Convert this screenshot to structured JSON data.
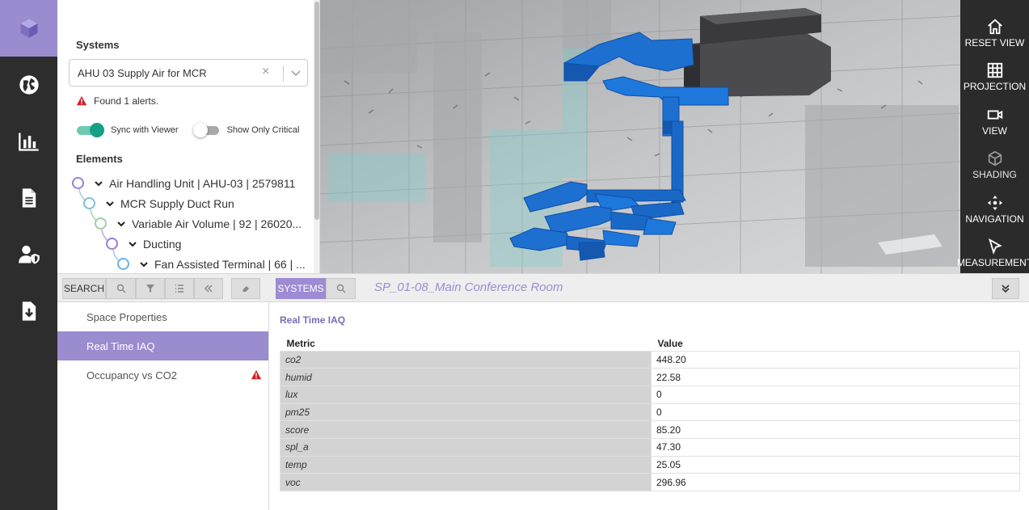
{
  "rail": {
    "items": [
      {
        "icon": "cube-icon",
        "active": true
      },
      {
        "icon": "globe-icon",
        "active": false
      },
      {
        "icon": "bar-chart-icon",
        "active": false
      },
      {
        "icon": "document-icon",
        "active": false
      },
      {
        "icon": "user-shield-icon",
        "active": false
      },
      {
        "icon": "download-file-icon",
        "active": false
      }
    ]
  },
  "systems_panel": {
    "title": "Systems",
    "selected_system": "AHU 03 Supply Air for MCR",
    "alert_text": "Found 1 alerts.",
    "sync_label": "Sync with Viewer",
    "sync_on": true,
    "critical_label": "Show Only Critical",
    "critical_on": false,
    "elements_title": "Elements",
    "tree": [
      {
        "label": "Air Handling Unit | AHU-03 | 2579811",
        "color": "#9b7fd4"
      },
      {
        "label": "MCR Supply Duct Run",
        "color": "#7fbfd0"
      },
      {
        "label": "Variable Air Volume | 92 | 26020...",
        "color": "#9fd0a8"
      },
      {
        "label": "Ducting",
        "color": "#9b7fd4"
      },
      {
        "label": "Fan Assisted Terminal | 66 | ...",
        "color": "#6fb3e0"
      }
    ]
  },
  "toolbar": {
    "reset_view": "RESET VIEW",
    "projection": "PROJECTION",
    "view": "VIEW",
    "shading": "SHADING",
    "navigation": "NAVIGATION",
    "measurement": "MEASUREMENT"
  },
  "bar": {
    "search_label": "SEARCH",
    "systems_label": "SYSTEMS",
    "space_title": "SP_01-08_Main Conference Room"
  },
  "properties_nav": {
    "items": [
      {
        "label": "Space Properties",
        "active": false,
        "alert": false
      },
      {
        "label": "Real Time IAQ",
        "active": true,
        "alert": false
      },
      {
        "label": "Occupancy vs CO2",
        "active": false,
        "alert": true
      }
    ]
  },
  "iaq": {
    "title": "Real Time IAQ",
    "col_metric": "Metric",
    "col_value": "Value",
    "rows": [
      {
        "metric": "co2",
        "value": "448.20"
      },
      {
        "metric": "humid",
        "value": "22.58"
      },
      {
        "metric": "lux",
        "value": "0"
      },
      {
        "metric": "pm25",
        "value": "0"
      },
      {
        "metric": "score",
        "value": "85.20"
      },
      {
        "metric": "spl_a",
        "value": "47.30"
      },
      {
        "metric": "temp",
        "value": "25.05"
      },
      {
        "metric": "voc",
        "value": "296.96"
      }
    ]
  },
  "colors": {
    "accent": "#9b8cd0",
    "duct_blue": "#1d6fd0",
    "alert_red": "#d11f26",
    "toggle_on": "#14a084"
  }
}
